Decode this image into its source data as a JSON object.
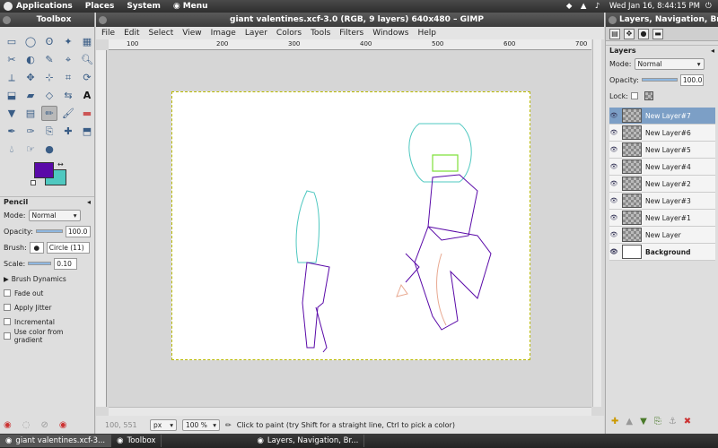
{
  "top_panel": {
    "menus": [
      "Applications",
      "Places",
      "System",
      "Menu"
    ],
    "clock": "Wed Jan 16,  8:44:15 PM"
  },
  "toolbox": {
    "title": "Toolbox",
    "tool_options": {
      "title": "Pencil",
      "mode_label": "Mode:",
      "mode_value": "Normal",
      "opacity_label": "Opacity:",
      "opacity_value": "100.0",
      "brush_label": "Brush:",
      "brush_value": "Circle (11)",
      "scale_label": "Scale:",
      "scale_value": "0.10",
      "brush_dynamics": "Brush Dynamics",
      "checks": [
        "Fade out",
        "Apply Jitter",
        "Incremental",
        "Use color from gradient"
      ]
    },
    "colors": {
      "fg": "#5a0aa8",
      "bg": "#4fc8c0"
    }
  },
  "main_window": {
    "title": "giant valentines.xcf-3.0 (RGB, 9 layers) 640x480 – GIMP",
    "menus": [
      "File",
      "Edit",
      "Select",
      "View",
      "Image",
      "Layer",
      "Colors",
      "Tools",
      "Filters",
      "Windows",
      "Help"
    ],
    "ruler_ticks": [
      "100",
      "200",
      "300",
      "400",
      "500",
      "600",
      "700"
    ],
    "status": {
      "coords": "100, 551",
      "unit": "px",
      "zoom": "100 %",
      "message": "Click to paint (try Shift for a straight line, Ctrl to pick a color)"
    }
  },
  "layers_window": {
    "title": "Layers, Navigation, Br...",
    "panel_title": "Layers",
    "mode_label": "Mode:",
    "mode_value": "Normal",
    "opacity_label": "Opacity:",
    "opacity_value": "100.0",
    "lock_label": "Lock:",
    "layers": [
      {
        "name": "New Layer#7",
        "active": true
      },
      {
        "name": "New Layer#6"
      },
      {
        "name": "New Layer#5"
      },
      {
        "name": "New Layer#4"
      },
      {
        "name": "New Layer#2"
      },
      {
        "name": "New Layer#3"
      },
      {
        "name": "New Layer#1"
      },
      {
        "name": "New Layer"
      },
      {
        "name": "Background"
      }
    ]
  },
  "taskbar": {
    "tasks": [
      "giant valentines.xcf-3...",
      "Toolbox",
      "Layers, Navigation, Br..."
    ]
  }
}
